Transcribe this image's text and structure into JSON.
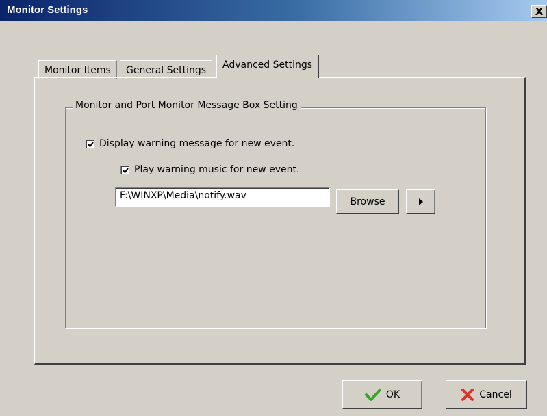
{
  "window": {
    "title": "Monitor Settings",
    "close_glyph": "X"
  },
  "tabs": [
    {
      "label": "Monitor Items",
      "active": false
    },
    {
      "label": "General Settings",
      "active": false
    },
    {
      "label": "Advanced Settings",
      "active": true
    }
  ],
  "group": {
    "title": "Monitor and Port Monitor Message Box Setting",
    "display_warning": {
      "label": "Display warning message for new event.",
      "checked": true
    },
    "play_music": {
      "label": "Play warning music for new event.",
      "checked": true
    },
    "sound_file": {
      "value": "F:\\WINXP\\Media\\notify.wav"
    },
    "browse_label": "Browse",
    "play_icon": "play-icon"
  },
  "footer": {
    "ok_label": "OK",
    "ok_icon": "checkmark-icon",
    "cancel_label": "Cancel",
    "cancel_icon": "x-icon"
  },
  "colors": {
    "titlebar_start": "#0a246a",
    "titlebar_end": "#a6caf0",
    "face": "#d4d0c8",
    "ok_green": "#3aa52a",
    "cancel_red": "#d8342a"
  }
}
